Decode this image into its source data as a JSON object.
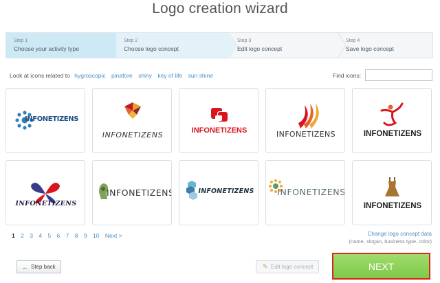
{
  "page": {
    "title": "Logo creation wizard"
  },
  "steps": [
    {
      "number": "Step 1",
      "label": "Choose your activity type"
    },
    {
      "number": "Step 2",
      "label": "Choose logo concept"
    },
    {
      "number": "Step 3",
      "label": "Edit logo concept"
    },
    {
      "number": "Step 4",
      "label": "Save logo concept"
    }
  ],
  "related": {
    "label": "Look at icons related to",
    "keywords": [
      "hygroscopic",
      "pinafore",
      "shiny",
      "key of life",
      "sun shine"
    ]
  },
  "find": {
    "label": "Find icons:",
    "value": ""
  },
  "logos": [
    {
      "name": "INFONETIZENS",
      "icon": "gear-circle-icon"
    },
    {
      "name": "INFONETIZENS",
      "icon": "pinwheel-icon"
    },
    {
      "name": "INFONETIZENS",
      "icon": "red-squares-icon"
    },
    {
      "name": "INFONETIZENS",
      "icon": "flame-stripes-icon"
    },
    {
      "name": "INFONETIZENS",
      "icon": "dancer-figure-icon"
    },
    {
      "name": "INFONETIZENS",
      "icon": "butterfly-icon"
    },
    {
      "name": "INFONETIZENS",
      "icon": "head-profile-icon"
    },
    {
      "name": "INFONETIZENS",
      "icon": "hexagon-cube-icon"
    },
    {
      "name": "INFONETIZENS",
      "icon": "sun-flower-icon"
    },
    {
      "name": "INFONETIZENS",
      "icon": "dress-icon"
    }
  ],
  "pagination": {
    "pages": [
      "1",
      "2",
      "3",
      "4",
      "5",
      "6",
      "7",
      "8",
      "9",
      "10"
    ],
    "current": "1",
    "next": "Next >"
  },
  "change": {
    "link": "Change logo concept data",
    "hint": "(name, slogan, business type, color)"
  },
  "buttons": {
    "back": "Step back",
    "edit": "Edit logo concept",
    "next": "NEXT"
  },
  "colors": {
    "accent_link": "#4a8fc6",
    "next_green": "#8fd35a",
    "next_border": "#d9251a",
    "logo_red": "#d7161e"
  }
}
